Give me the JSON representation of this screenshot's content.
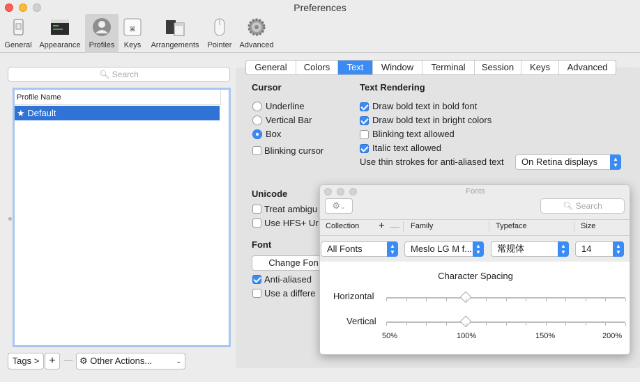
{
  "window": {
    "title": "Preferences"
  },
  "toolbar": {
    "items": [
      {
        "label": "General",
        "icon": "phone-icon"
      },
      {
        "label": "Appearance",
        "icon": "window-icon"
      },
      {
        "label": "Profiles",
        "icon": "profile-icon",
        "selected": true
      },
      {
        "label": "Keys",
        "icon": "command-key-icon"
      },
      {
        "label": "Arrangements",
        "icon": "arrangements-icon"
      },
      {
        "label": "Pointer",
        "icon": "mouse-icon"
      },
      {
        "label": "Advanced",
        "icon": "gear-icon"
      }
    ]
  },
  "left": {
    "search_placeholder": "Search",
    "column_header": "Profile Name",
    "profiles": [
      {
        "name": "★ Default",
        "selected": true
      }
    ],
    "tags_label": "Tags >",
    "add_label": "+",
    "remove_label": "—",
    "other_actions_label": "Other Actions..."
  },
  "tabs": [
    "General",
    "Colors",
    "Text",
    "Window",
    "Terminal",
    "Session",
    "Keys",
    "Advanced"
  ],
  "selected_tab": "Text",
  "cursor": {
    "heading": "Cursor",
    "options": [
      "Underline",
      "Vertical Bar",
      "Box"
    ],
    "selected": "Box",
    "blinking_label": "Blinking cursor"
  },
  "text_rendering": {
    "heading": "Text Rendering",
    "options": [
      {
        "label": "Draw bold text in bold font",
        "checked": true
      },
      {
        "label": "Draw bold text in bright colors",
        "checked": true
      },
      {
        "label": "Blinking text allowed",
        "checked": false
      },
      {
        "label": "Italic text allowed",
        "checked": true
      }
    ],
    "thin_strokes_label": "Use thin strokes for anti-aliased text",
    "thin_strokes_value": "On Retina displays"
  },
  "unicode": {
    "heading": "Unicode",
    "option1": "Treat ambigu",
    "option2": "Use HFS+ Ur"
  },
  "font": {
    "heading": "Font",
    "change_button": "Change Fon",
    "anti_aliased": "Anti-aliased",
    "use_different": "Use a differe"
  },
  "fonts_panel": {
    "title": "Fonts",
    "search_placeholder": "Search",
    "columns": {
      "collection": "Collection",
      "family": "Family",
      "typeface": "Typeface",
      "size": "Size"
    },
    "collection_value": "All Fonts",
    "family_value": "Meslo LG M f...",
    "typeface_value": "常规体",
    "size_value": "14",
    "spacing_heading": "Character Spacing",
    "horizontal_label": "Horizontal",
    "vertical_label": "Vertical",
    "horizontal_value_pct": 100,
    "vertical_value_pct": 100,
    "scale_labels": [
      "50%",
      "100%",
      "150%",
      "200%"
    ]
  },
  "colors": {
    "accent": "#3a8cf4",
    "selection": "#2f73d6"
  }
}
